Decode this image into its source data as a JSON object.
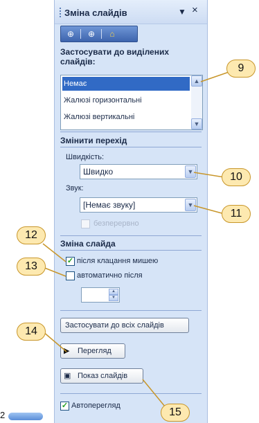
{
  "panel": {
    "title": "Зміна слайдів",
    "dropdown_glyph": "▼",
    "close_glyph": "×"
  },
  "nav": {
    "back_glyph": "⊕",
    "forward_glyph": "⊕",
    "home_glyph": "⌂"
  },
  "apply_section": {
    "heading": "Застосувати до виділених слайдів:",
    "items": [
      "Немає",
      "Жалюзі горизонтальні",
      "Жалюзі вертикальні"
    ],
    "selected": "Немає"
  },
  "transition": {
    "heading": "Змінити перехід",
    "speed_label": "Швидкість:",
    "speed_value": "Швидко",
    "sound_label": "Звук:",
    "sound_value": "[Немає звуку]",
    "loop_label": "безперервно"
  },
  "advance": {
    "heading": "Зміна слайда",
    "on_click_label": "після клацання мишею",
    "on_click_checked": true,
    "auto_label": "автоматично після",
    "auto_checked": false,
    "auto_value": ""
  },
  "buttons": {
    "apply_all": "Застосувати до всіх слайдів",
    "preview": "Перегляд",
    "slideshow": "Показ слайдів"
  },
  "autopreview": {
    "label": "Автоперегляд",
    "checked": true
  },
  "callouts": [
    "9",
    "10",
    "11",
    "12",
    "13",
    "14",
    "15"
  ],
  "side_number": "2",
  "colors": {
    "pane_bg": "#d6e4f7",
    "selection": "#316ac5",
    "callout_fill": "#fde9b0",
    "callout_border": "#c8962a",
    "check": "#21a121"
  }
}
